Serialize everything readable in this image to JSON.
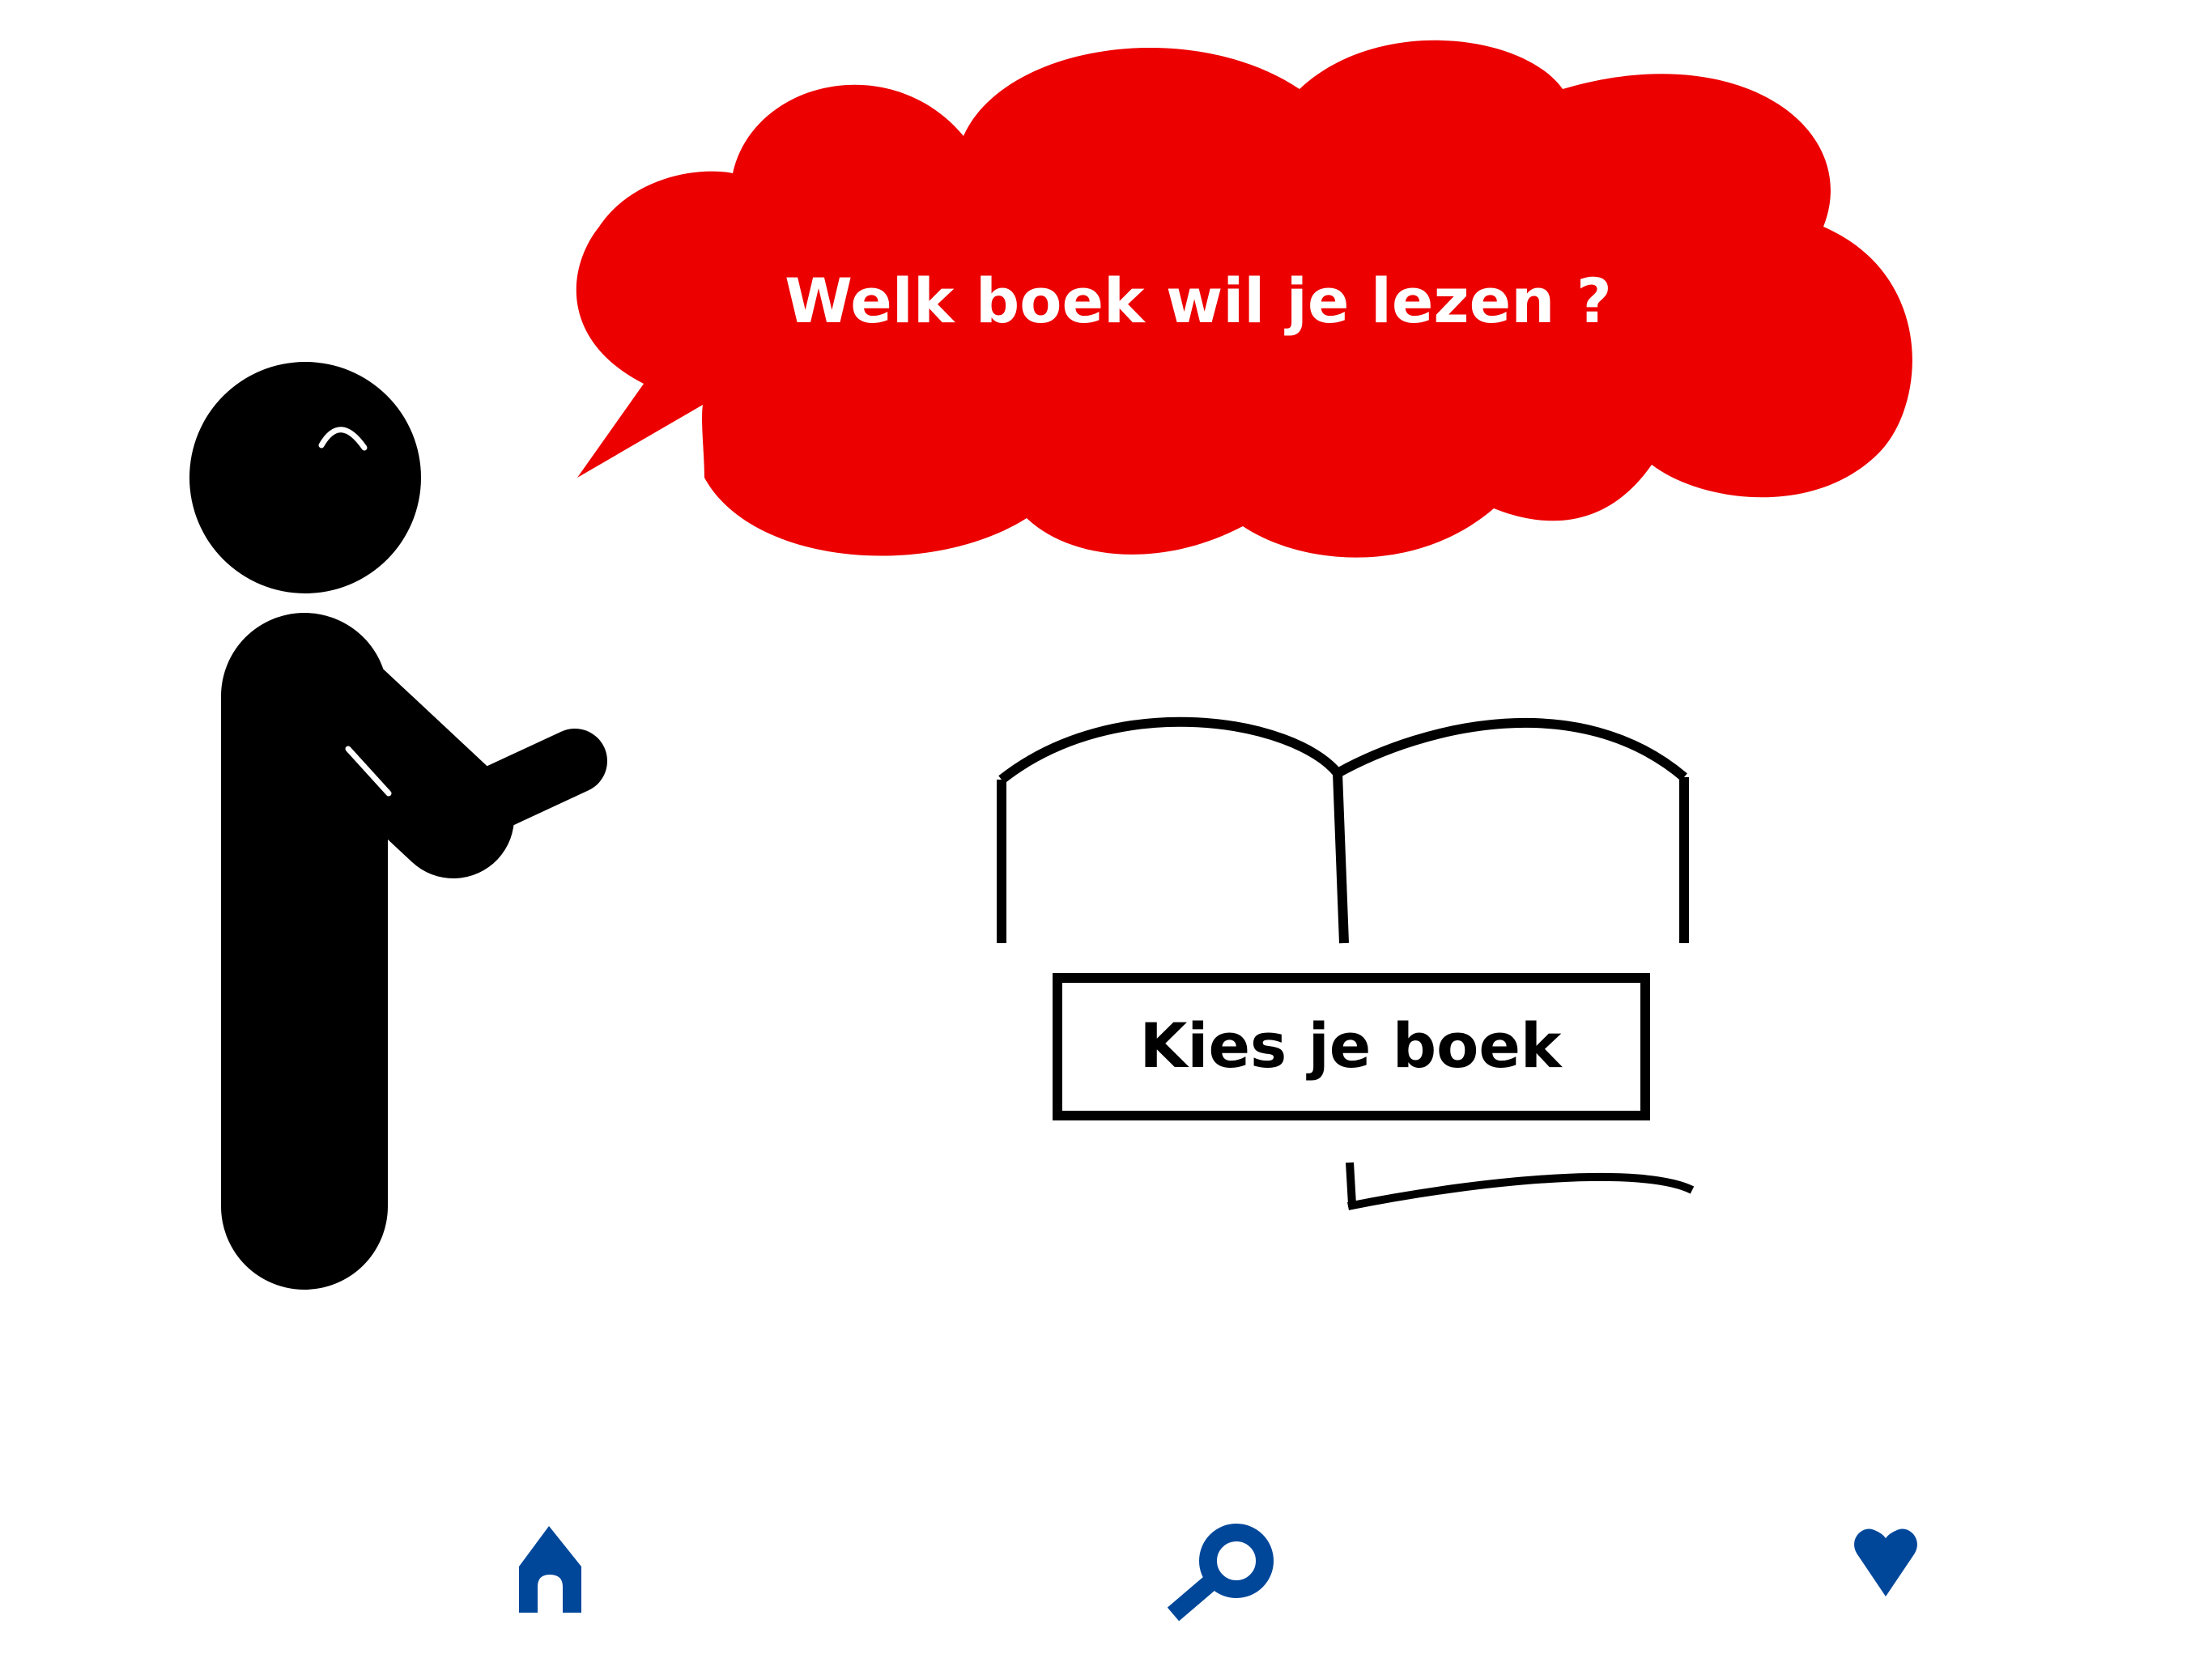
{
  "speech_bubble": {
    "text": "Welk boek wil je lezen ?",
    "color": "#EC0000"
  },
  "choose_button": {
    "label": "Kies je boek"
  },
  "figure": {
    "color": "#000000"
  },
  "nav": {
    "color": "#00479A",
    "items": [
      {
        "icon": "home-icon"
      },
      {
        "icon": "search-icon"
      },
      {
        "icon": "heart-icon"
      }
    ]
  }
}
